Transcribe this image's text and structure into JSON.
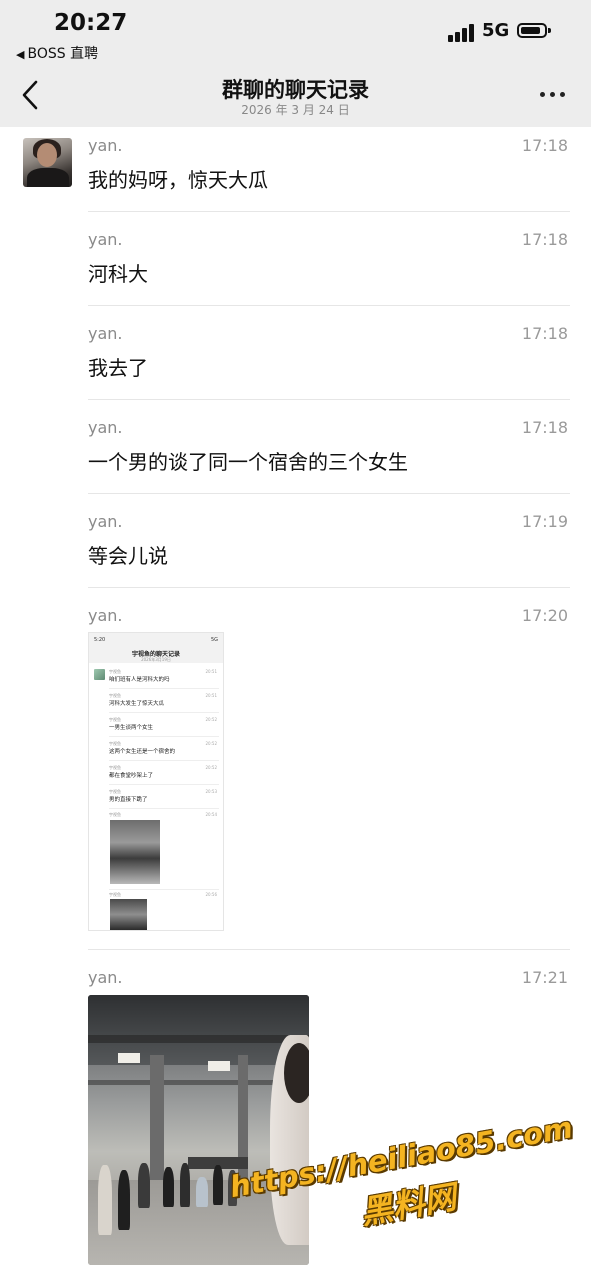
{
  "status_bar": {
    "time": "20:27",
    "back_app": "BOSS 直聘",
    "network": "5G"
  },
  "header": {
    "title": "群聊的聊天记录",
    "date": "2026 年 3 月 24 日"
  },
  "messages": [
    {
      "sender": "yan.",
      "time": "17:18",
      "text": "我的妈呀，惊天大瓜"
    },
    {
      "sender": "yan.",
      "time": "17:18",
      "text": "河科大"
    },
    {
      "sender": "yan.",
      "time": "17:18",
      "text": "我去了"
    },
    {
      "sender": "yan.",
      "time": "17:18",
      "text": "一个男的谈了同一个宿舍的三个女生"
    },
    {
      "sender": "yan.",
      "time": "17:19",
      "text": "等会儿说"
    },
    {
      "sender": "yan.",
      "time": "17:20",
      "type": "image"
    },
    {
      "sender": "yan.",
      "time": "17:21",
      "type": "image"
    }
  ],
  "nested_screenshot": {
    "status_time": "5:20",
    "status_right": "5G",
    "title": "宇视鱼的聊天记录",
    "date": "2026年3月19日",
    "rows": [
      {
        "name": "宇视鱼",
        "time": "20:51",
        "text": "咱们班有人是河科大的吗"
      },
      {
        "name": "宇视鱼",
        "time": "20:51",
        "text": "河科大发生了惊天大瓜"
      },
      {
        "name": "宇视鱼",
        "time": "20:52",
        "text": "一男生谈两个女生"
      },
      {
        "name": "宇视鱼",
        "time": "20:52",
        "text": "这两个女生还是一个宿舍的"
      },
      {
        "name": "宇视鱼",
        "time": "20:52",
        "text": "都在食堂吵架上了"
      },
      {
        "name": "宇视鱼",
        "time": "20:53",
        "text": "男的直接下跪了"
      },
      {
        "name": "宇视鱼",
        "time": "20:54",
        "text": ""
      },
      {
        "name": "宇视鱼",
        "time": "20:56",
        "text": ""
      }
    ]
  },
  "watermark": {
    "url": "https://heiliao85.com",
    "name": "黑料网"
  }
}
